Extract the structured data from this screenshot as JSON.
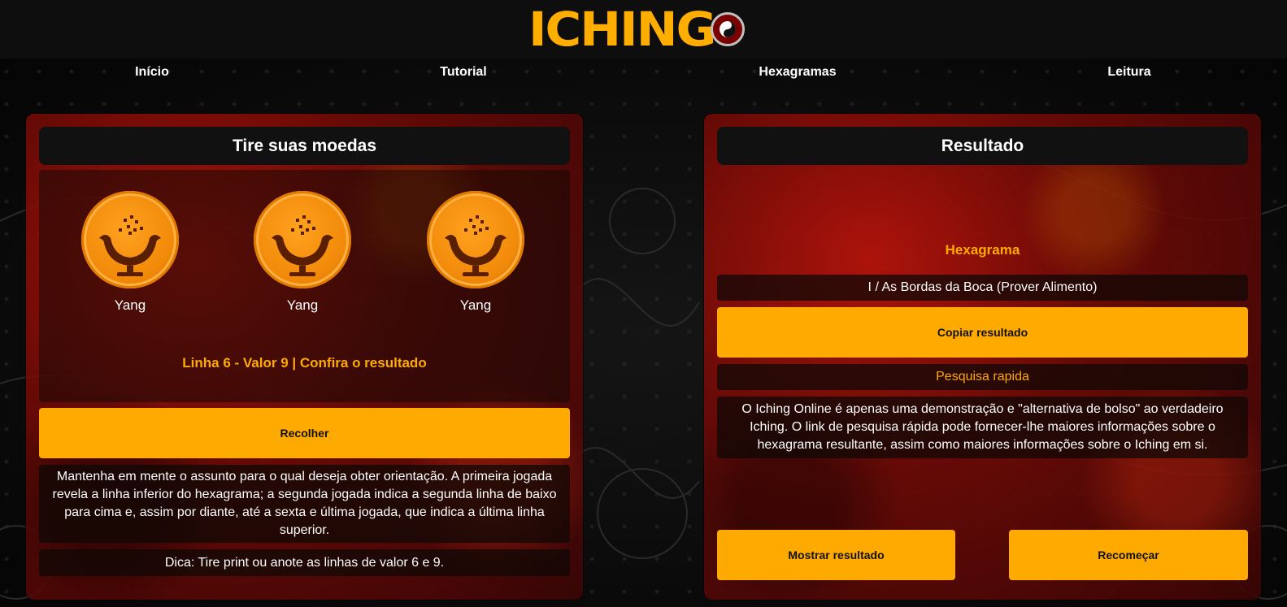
{
  "header": {
    "logo_text": "ICHING",
    "logo_icon": "yin-yang-icon"
  },
  "nav": {
    "items": [
      {
        "label": "Início"
      },
      {
        "label": "Tutorial"
      },
      {
        "label": "Hexagramas"
      },
      {
        "label": "Leitura"
      }
    ]
  },
  "left_panel": {
    "title": "Tire suas moedas",
    "coins": [
      {
        "label": "Yang",
        "icon": "offering-bowl-icon"
      },
      {
        "label": "Yang",
        "icon": "offering-bowl-icon"
      },
      {
        "label": "Yang",
        "icon": "offering-bowl-icon"
      }
    ],
    "line_result": "Linha 6 - Valor 9 | Confira o resultado",
    "collect_button": "Recolher",
    "instructions": "Mantenha em mente o assunto para o qual deseja obter orientação. A primeira jogada revela a linha inferior do hexagrama; a segunda jogada indica a segunda linha de baixo para cima e, assim por diante, até a sexta e última jogada, que indica a última linha superior.",
    "tip": "Dica: Tire print ou anote as linhas de valor 6 e 9."
  },
  "right_panel": {
    "title": "Resultado",
    "hexagram_label": "Hexagrama",
    "hexagram_name": "I / As Bordas da Boca (Prover Alimento)",
    "copy_button": "Copiar resultado",
    "quick_search": "Pesquisa rapida",
    "description": "O Iching Online é apenas uma demonstração e \"alternativa de bolso\" ao verdadeiro Iching. O link de pesquisa rápida pode fornecer-lhe maiores informações sobre o hexagrama resultante, assim como maiores informações sobre o Iching em si.",
    "show_button": "Mostrar resultado",
    "restart_button": "Recomeçar"
  },
  "colors": {
    "accent": "#ffaa00",
    "panel_red": "#b01208",
    "dark": "#111111"
  }
}
